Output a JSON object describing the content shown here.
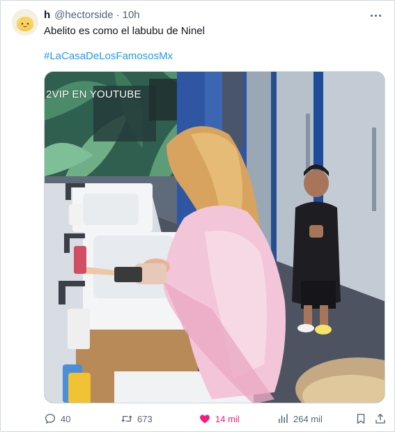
{
  "user": {
    "display_name": "h",
    "handle": "@hectorside",
    "separator": "·",
    "time": "10h",
    "avatar_icon": "smiley-emoji-icon"
  },
  "tweet": {
    "text": "Abelito es como el labubu de Ninel",
    "hashtag": "#LaCasaDeLosFamososMx"
  },
  "media": {
    "watermark": "2VIP EN YOUTUBE"
  },
  "actions": {
    "replies": "40",
    "retweets": "673",
    "likes": "14 mil",
    "views": "264 mil"
  },
  "colors": {
    "accent": "#1d9bf0",
    "like": "#f91880",
    "secondary_text": "#536471"
  }
}
